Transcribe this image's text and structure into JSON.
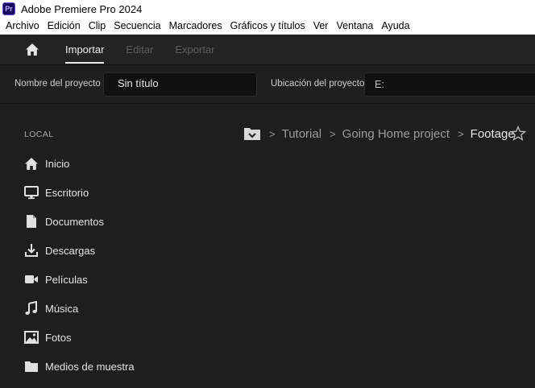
{
  "window": {
    "title": "Adobe Premiere Pro 2024",
    "app_icon_text": "Pr"
  },
  "menubar": {
    "items": [
      "Archivo",
      "Edición",
      "Clip",
      "Secuencia",
      "Marcadores",
      "Gráficos y títulos",
      "Ver",
      "Ventana",
      "Ayuda"
    ]
  },
  "topnav": {
    "tabs": [
      {
        "label": "Importar",
        "active": true
      },
      {
        "label": "Editar",
        "active": false
      },
      {
        "label": "Exportar",
        "active": false
      }
    ]
  },
  "project": {
    "name_label": "Nombre del proyecto",
    "name_value": "Sin título",
    "location_label": "Ubicación del proyecto",
    "location_value": "E:"
  },
  "sidebar": {
    "section": "LOCAL",
    "items": [
      {
        "label": "Inicio",
        "icon": "home-icon"
      },
      {
        "label": "Escritorio",
        "icon": "desktop-icon"
      },
      {
        "label": "Documentos",
        "icon": "document-icon"
      },
      {
        "label": "Descargas",
        "icon": "download-icon"
      },
      {
        "label": "Películas",
        "icon": "video-camera-icon"
      },
      {
        "label": "Música",
        "icon": "music-icon"
      },
      {
        "label": "Fotos",
        "icon": "image-icon"
      },
      {
        "label": "Medios de muestra",
        "icon": "folder-icon"
      }
    ]
  },
  "breadcrumb": {
    "items": [
      "Tutorial",
      "Going Home project",
      "Footage"
    ],
    "separator": ">"
  },
  "colors": {
    "background": "#1e1e1e",
    "text": "#e4e4e4",
    "muted": "#9d9d9d"
  }
}
